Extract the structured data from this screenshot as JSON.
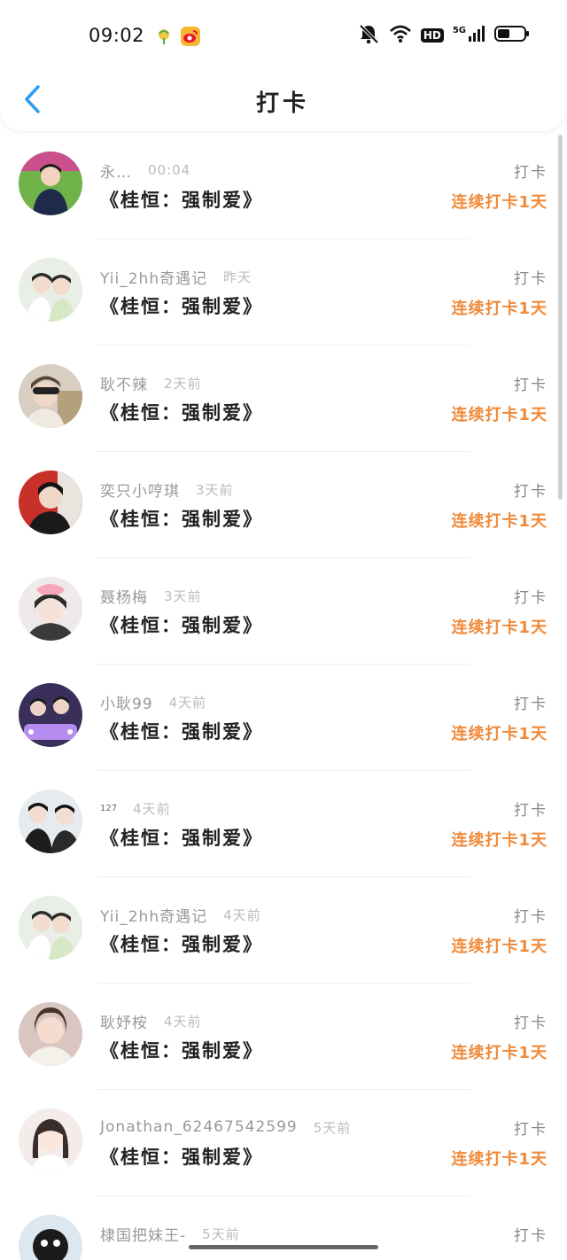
{
  "status_bar": {
    "time": "09:02",
    "network_label": "5G",
    "hd_label": "HD",
    "icons": [
      "leaf-app-icon",
      "weibo-icon",
      "mute-bell-icon",
      "wifi-icon",
      "signal-icon",
      "battery-icon"
    ]
  },
  "header": {
    "title": "打卡",
    "back_icon": "chevron-left-icon"
  },
  "colors": {
    "accent_blue": "#2a9df4",
    "streak_orange": "#f08a3a",
    "title_text": "#222222",
    "muted_text": "#999999"
  },
  "rows": [
    {
      "username": "永…",
      "time": "00:04",
      "book": "《桂恒：强制爱》",
      "action": "打卡",
      "streak": "连续打卡1天"
    },
    {
      "username": "Yii_2hh奇遇记",
      "time": "昨天",
      "book": "《桂恒：强制爱》",
      "action": "打卡",
      "streak": "连续打卡1天"
    },
    {
      "username": "耿不辣",
      "time": "2天前",
      "book": "《桂恒：强制爱》",
      "action": "打卡",
      "streak": "连续打卡1天"
    },
    {
      "username": "奕只小哼琪",
      "time": "3天前",
      "book": "《桂恒：强制爱》",
      "action": "打卡",
      "streak": "连续打卡1天"
    },
    {
      "username": "聂杨梅",
      "time": "3天前",
      "book": "《桂恒：强制爱》",
      "action": "打卡",
      "streak": "连续打卡1天"
    },
    {
      "username": "小耿99",
      "time": "4天前",
      "book": "《桂恒：强制爱》",
      "action": "打卡",
      "streak": "连续打卡1天"
    },
    {
      "username": "127",
      "time": "4天前",
      "book": "《桂恒：强制爱》",
      "action": "打卡",
      "streak": "连续打卡1天"
    },
    {
      "username": "Yii_2hh奇遇记",
      "time": "4天前",
      "book": "《桂恒：强制爱》",
      "action": "打卡",
      "streak": "连续打卡1天"
    },
    {
      "username": "耿妤桉",
      "time": "4天前",
      "book": "《桂恒：强制爱》",
      "action": "打卡",
      "streak": "连续打卡1天"
    },
    {
      "username": "Jonathan_62467542599",
      "time": "5天前",
      "book": "《桂恒：强制爱》",
      "action": "打卡",
      "streak": "连续打卡1天"
    },
    {
      "username": "棣国把妹王-",
      "time": "5天前",
      "book": "",
      "action": "打卡",
      "streak": ""
    }
  ]
}
